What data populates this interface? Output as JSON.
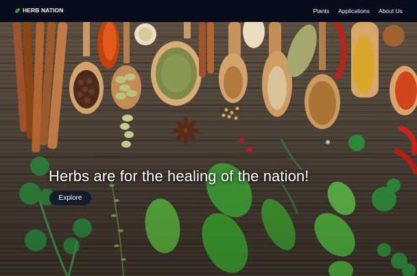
{
  "navbar": {
    "brand": "HERB NATION",
    "links": [
      "Plants",
      "Applications",
      "About Us"
    ]
  },
  "hero": {
    "title": "Herbs are for the healing of the nation!",
    "cta_label": "Explore"
  },
  "colors": {
    "navbar_bg": "#070b1c",
    "cta_bg": "#141c2b",
    "brand_leaf": "#3aa54a"
  },
  "icons": [
    "leaf-icon"
  ]
}
